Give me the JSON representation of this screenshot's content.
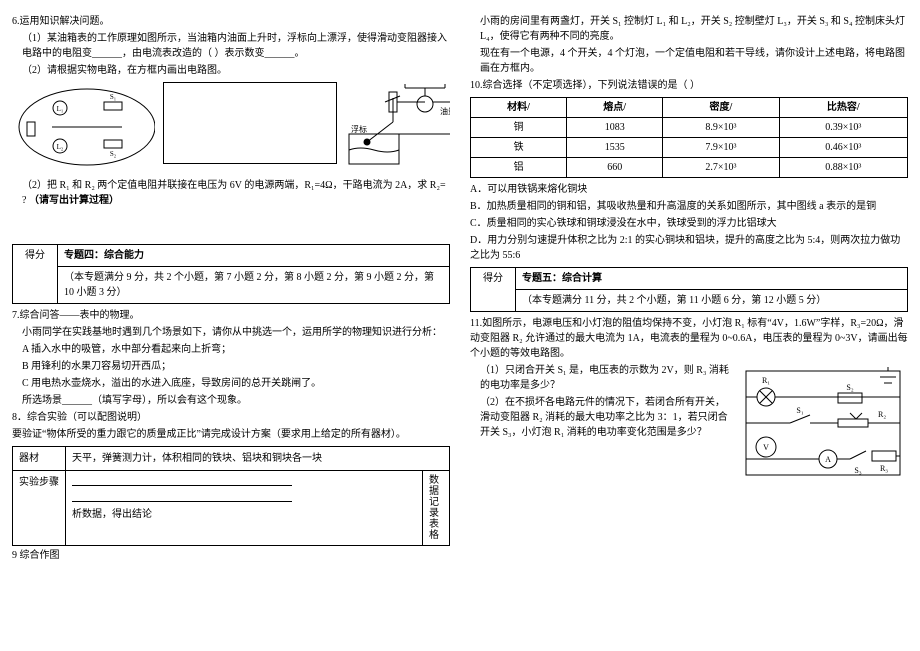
{
  "left": {
    "q6": {
      "num": "6.运用知识解决问题。",
      "p1": "（1）某油箱表的工作原理如图所示，当油箱内油面上升时，浮标向上漂浮，使得滑动变阻器接入电路中的电阻变______，由电流表改造的（     ）表示数变______。",
      "p2": "（2）请根据实物电路，在方框内画出电路图。",
      "fig_label_oil": "油量表",
      "fig_label_float": "浮标",
      "p3_pre": "（2）把 R₁ 和 R₂ 两个定值电阻并联接在电压为 6V 的电源两端，R₁=4Ω，干路电流为 2A，求 R₂= ?  ",
      "p3_bold": "（请写出计算过程）"
    },
    "section4": {
      "label": "得分",
      "title": "专题四：综合能力",
      "desc": "（本专题满分 9 分，共 2 个小题，第 7 小题 2 分，第 8 小题 2 分，第 9 小题 2 分，第 10 小题 3 分）"
    },
    "q7": {
      "num": "7.综合问答——表中的物理。",
      "p1": "小雨同学在实践基地时遇到几个场景如下，请你从中挑选一个，运用所学的物理知识进行分析：",
      "a": "A 插入水中的吸管，水中部分看起来向上折弯；",
      "b": "B 用锋利的水果刀容易切开西瓜；",
      "c": "C 用电热水壶烧水，溢出的水进入底座，导致房间的总开关跳闸了。",
      "choose": "所选场景______（填写字母），所以会有这个现象。"
    },
    "q8": {
      "num": "8．综合实验（可以配图说明）",
      "aim": "要验证“物体所受的重力跟它的质量成正比”请完成设计方案（要求用上给定的所有器材）。",
      "row_equip_label": "器材",
      "row_steps_label": "实验步骤",
      "equip": "天平，弹簧测力计，体积相同的铁块、铝块和铜块各一块",
      "steps_line3": "析数据，得出结论",
      "col_data": "数\n据\n记\n录\n表\n格"
    },
    "q9": "9 综合作图"
  },
  "right": {
    "intro": {
      "p1": "小雨的房间里有两盏灯，开关 S₁ 控制灯 L₁ 和 L₂，开关 S₂ 控制壁灯 L₃，开关 S₃ 和 S₄ 控制床头灯 L₄，使得它有两种不同的亮度。",
      "p2": "现在有一个电源，4 个开关，4 个灯泡，一个定值电阻和若干导线，请你设计上述电路，将电路图画在方框内。"
    },
    "q10": {
      "num": "10.综合选择（不定项选择），下列说法错误的是（     ）",
      "table": {
        "h1": "材料/",
        "h2": "熔点/",
        "h3": "密度/",
        "h4": "比热容/",
        "rows": [
          [
            "铜",
            "1083",
            "8.9×10³",
            "0.39×10³"
          ],
          [
            "铁",
            "1535",
            "7.9×10³",
            "0.46×10³"
          ],
          [
            "铝",
            "660",
            "2.7×10³",
            "0.88×10³"
          ]
        ]
      },
      "a": "A．可以用铁锅来熔化铜块",
      "b": "B．加热质量相同的铜和铝，其吸收热量和升高温度的关系如图所示，其中图线 a 表示的是铜",
      "c": "C．质量相同的实心铁球和铜球浸没在水中，铁球受到的浮力比铝球大",
      "d": "D．用力分别匀速提升体积之比为 2:1 的实心铜块和铝块，提升的高度之比为 5:4，则两次拉力做功之比为 55:6"
    },
    "section5": {
      "label": "得分",
      "title": "专题五：综合计算",
      "desc": "（本专题满分 11 分，共 2 个小题，第 11 小题 6 分，第 12 小题 5 分）"
    },
    "q11": {
      "num": "11.如图所示，电源电压和小灯泡的阻值均保持不变，小灯泡 R₁ 标有“4V，1.6W”字样，R₃=20Ω，滑动变阻器 R₂ 允许通过的最大电流为 1A，电流表的量程为 0~0.6A，电压表的量程为 0~3V，请画出每个小题的等效电路图。",
      "p1": "（1）只闭合开关 S₁ 是，电压表的示数为 2V，则 R₃ 消耗的电功率是多少？",
      "p2": "（2）在不损坏各电路元件的情况下，若闭合所有开关，滑动变阻器 R₂ 消耗的最大电功率之比为 3：1，若只闭合开关 S₃，小灯泡 R₁ 消耗的电功率变化范围是多少？"
    },
    "circuit_labels": {
      "R1": "R₁",
      "R2": "R₂",
      "R3": "R₃",
      "S1": "S₁",
      "S2": "S₂",
      "S3": "S₃",
      "V": "V",
      "A": "A"
    }
  }
}
